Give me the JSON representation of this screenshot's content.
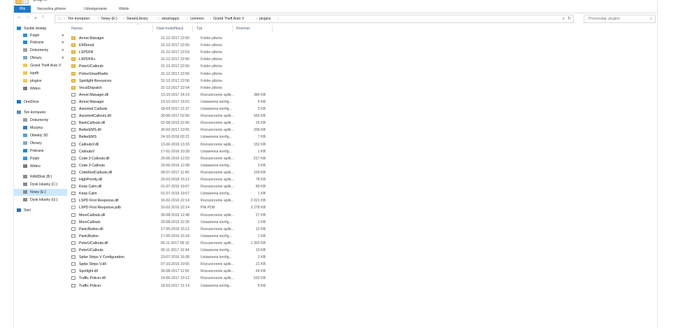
{
  "window": {
    "title": "plugins",
    "tabs": [
      "Plik",
      "Narzędzia główne",
      "Udostępnianie",
      "Widok"
    ]
  },
  "address": {
    "crumbs": [
      "Ten komputer",
      "Nowy (E:)",
      "SteamLibrary",
      "steamapps",
      "common",
      "Grand Theft Auto V",
      "plugins"
    ],
    "search_placeholder": "Przeszukaj: plugins"
  },
  "nav": {
    "items": [
      {
        "label": "Szybki dostęp",
        "icon": "star-icon",
        "pinned": false
      },
      {
        "label": "Pulpit",
        "icon": "desktop-icon",
        "pinned": true
      },
      {
        "label": "Pobrane",
        "icon": "download-icon",
        "pinned": true
      },
      {
        "label": "Dokumenty",
        "icon": "documents-icon",
        "pinned": true
      },
      {
        "label": "Obrazy",
        "icon": "pictures-icon",
        "pinned": true
      },
      {
        "label": "Grand Theft Auto V",
        "icon": "folder-icon",
        "pinned": false
      },
      {
        "label": "lspdfr",
        "icon": "folder-icon",
        "pinned": false
      },
      {
        "label": "plugins",
        "icon": "folder-icon",
        "pinned": false
      },
      {
        "label": "Wideo",
        "icon": "video-icon",
        "pinned": false
      },
      {
        "label": "OneDrive",
        "icon": "cloud-icon",
        "pinned": false
      },
      {
        "label": "Ten komputer",
        "icon": "computer-icon",
        "pinned": false
      },
      {
        "label": "Dokumenty",
        "icon": "documents-icon",
        "pinned": false
      },
      {
        "label": "Muzyka",
        "icon": "music-icon",
        "pinned": false
      },
      {
        "label": "Obiekty 3D",
        "icon": "cube-icon",
        "pinned": false
      },
      {
        "label": "Obrazy",
        "icon": "pictures-icon",
        "pinned": false
      },
      {
        "label": "Pobrane",
        "icon": "download-icon",
        "pinned": false
      },
      {
        "label": "Pulpit",
        "icon": "desktop-icon",
        "pinned": false
      },
      {
        "label": "Wideo",
        "icon": "video-icon",
        "pinned": false
      },
      {
        "label": "RAMDisk (B:)",
        "icon": "drive-icon",
        "pinned": false
      },
      {
        "label": "Dysk lokalny (C:)",
        "icon": "drive-icon",
        "pinned": false
      },
      {
        "label": "Nowy (E:)",
        "icon": "drive-icon",
        "pinned": false,
        "selected": true
      },
      {
        "label": "Dysk lokalny (G:)",
        "icon": "drive-icon",
        "pinned": false
      },
      {
        "label": "Sieć",
        "icon": "network-icon",
        "pinned": false
      }
    ]
  },
  "columns": [
    "Nazwa",
    "Data modyfikacji",
    "Typ",
    "Rozmiar"
  ],
  "files": [
    {
      "name": "Arrest Manager",
      "date": "31-12-2017 22:56",
      "type": "Folder plików",
      "size": "",
      "kind": "folder"
    },
    {
      "name": "EMSmod",
      "date": "31-12-2017 22:56",
      "type": "Folder plików",
      "size": "",
      "kind": "folder"
    },
    {
      "name": "LSPDFR",
      "date": "31-12-2017 22:53",
      "type": "Folder plików",
      "size": "",
      "kind": "folder"
    },
    {
      "name": "LSPDFR+",
      "date": "31-12-2017 22:56",
      "type": "Folder plików",
      "size": "",
      "kind": "folder"
    },
    {
      "name": "PeterUCallouts",
      "date": "31-12-2017 22:56",
      "type": "Folder plików",
      "size": "",
      "kind": "folder"
    },
    {
      "name": "PoliceSmartRadio",
      "date": "31-12-2017 22:56",
      "type": "Folder plików",
      "size": "",
      "kind": "folder"
    },
    {
      "name": "Spotlight Resources",
      "date": "31-12-2017 22:56",
      "type": "Folder plików",
      "size": "",
      "kind": "folder"
    },
    {
      "name": "VocalDispatch",
      "date": "31-12-2017 22:54",
      "type": "Folder plików",
      "size": "",
      "kind": "folder"
    },
    {
      "name": "Arrest Manager.dll",
      "date": "13-10-2017 14:19",
      "type": "Rozszerzenie aplik...",
      "size": "384 KB",
      "kind": "dll"
    },
    {
      "name": "Arrest Manager",
      "date": "13-10-2017 15:02",
      "type": "Ustawienia konfig...",
      "size": "4 KB",
      "kind": "cfg"
    },
    {
      "name": "Assorted Callouts",
      "date": "18-03-2017 21:37",
      "type": "Ustawienia konfig...",
      "size": "3 KB",
      "kind": "cfg"
    },
    {
      "name": "AssortedCallouts.dll",
      "date": "30-06-2017 02:00",
      "type": "Rozszerzenie aplik...",
      "size": "565 KB",
      "kind": "dll"
    },
    {
      "name": "BankCallouts.dll",
      "date": "02-08-2015 22:56",
      "type": "Rozszerzenie aplik...",
      "size": "25 KB",
      "kind": "dll"
    },
    {
      "name": "BetterEMS.dll",
      "date": "30-03-2017 10:55",
      "type": "Rozszerzenie aplik...",
      "size": "336 KB",
      "kind": "dll"
    },
    {
      "name": "BetterEMS",
      "date": "24-10-2016 02:21",
      "type": "Ustawienia konfig...",
      "size": "7 KB",
      "kind": "cfg"
    },
    {
      "name": "CalloutsV.dll",
      "date": "13-06-2016 13:33",
      "type": "Rozszerzenie aplik...",
      "size": "152 KB",
      "kind": "dll"
    },
    {
      "name": "CalloutsV",
      "date": "17-01-2016 10:28",
      "type": "Ustawienia konfig...",
      "size": "1 KB",
      "kind": "cfg"
    },
    {
      "name": "Code 3 Callouts.dll",
      "date": "29-06-2016 12:53",
      "type": "Rozszerzenie aplik...",
      "size": "517 KB",
      "kind": "dll"
    },
    {
      "name": "Code 3 Callouts",
      "date": "29-06-2016 12:08",
      "type": "Ustawienia konfig...",
      "size": "3 KB",
      "kind": "cfg"
    },
    {
      "name": "CodeRedCallouts.dll",
      "date": "08-07-2017 11:45",
      "type": "Rozszerzenie aplik...",
      "size": "100 KB",
      "kind": "dll"
    },
    {
      "name": "HighPriority.dll",
      "date": "29-03-2018 15:12",
      "type": "Rozszerzenie aplik...",
      "size": "78 KB",
      "kind": "dll"
    },
    {
      "name": "Keep Calm.dll",
      "date": "01-07-2016 19:07",
      "type": "Rozszerzenie aplik...",
      "size": "80 KB",
      "kind": "dll"
    },
    {
      "name": "Keep Calm",
      "date": "01-07-2016 19:07",
      "type": "Ustawienia konfig...",
      "size": "1 KB",
      "kind": "cfg"
    },
    {
      "name": "LSPD First Response.dll",
      "date": "16-02-2016 22:14",
      "type": "Rozszerzenie aplik...",
      "size": "3 021 KB",
      "kind": "dll"
    },
    {
      "name": "LSPD First Response.pdb",
      "date": "16-02-2016 22:14",
      "type": "Plik PDB",
      "size": "3 278 KB",
      "kind": "pdb"
    },
    {
      "name": "MoreCallouts.dll",
      "date": "30-08-2015 12:48",
      "type": "Rozszerzenie aplik...",
      "size": "27 KB",
      "kind": "dll"
    },
    {
      "name": "MoreCallouts",
      "date": "29-08-2015 22:35",
      "type": "Ustawienia konfig...",
      "size": "1 KB",
      "kind": "cfg"
    },
    {
      "name": "PanicButton.dll",
      "date": "17-05-2016 15:12",
      "type": "Rozszerzenie aplik...",
      "size": "12 KB",
      "kind": "dll"
    },
    {
      "name": "PanicButton",
      "date": "17-05-2016 15:24",
      "type": "Ustawienia konfig...",
      "size": "1 KB",
      "kind": "cfg"
    },
    {
      "name": "PeterUCallouts.dll",
      "date": "06-11-2017 06:15",
      "type": "Rozszerzenie aplik...",
      "size": "1 303 KB",
      "kind": "dll"
    },
    {
      "name": "PeterUCallouts",
      "date": "05-11-2017 10:34",
      "type": "Ustawienia konfig...",
      "size": "10 KB",
      "kind": "cfg"
    },
    {
      "name": "Spike Strips V Configuration",
      "date": "23-07-2016 16:38",
      "type": "Ustawienia konfig...",
      "size": "2 KB",
      "kind": "cfg"
    },
    {
      "name": "Spike Strips V.dll",
      "date": "07-10-2016 20:55",
      "type": "Rozszerzenie aplik...",
      "size": "21 KB",
      "kind": "dll"
    },
    {
      "name": "Spotlight.dll",
      "date": "30-08-2017 11:50",
      "type": "Rozszerzenie aplik...",
      "size": "64 KB",
      "kind": "dll"
    },
    {
      "name": "Traffic Policer.dll",
      "date": "14-06-2017 19:12",
      "type": "Rozszerzenie aplik...",
      "size": "532 KB",
      "kind": "dll"
    },
    {
      "name": "Traffic Policer",
      "date": "18-03-2017 21:14",
      "type": "Ustawienia konfig...",
      "size": "8 KB",
      "kind": "cfg"
    }
  ]
}
